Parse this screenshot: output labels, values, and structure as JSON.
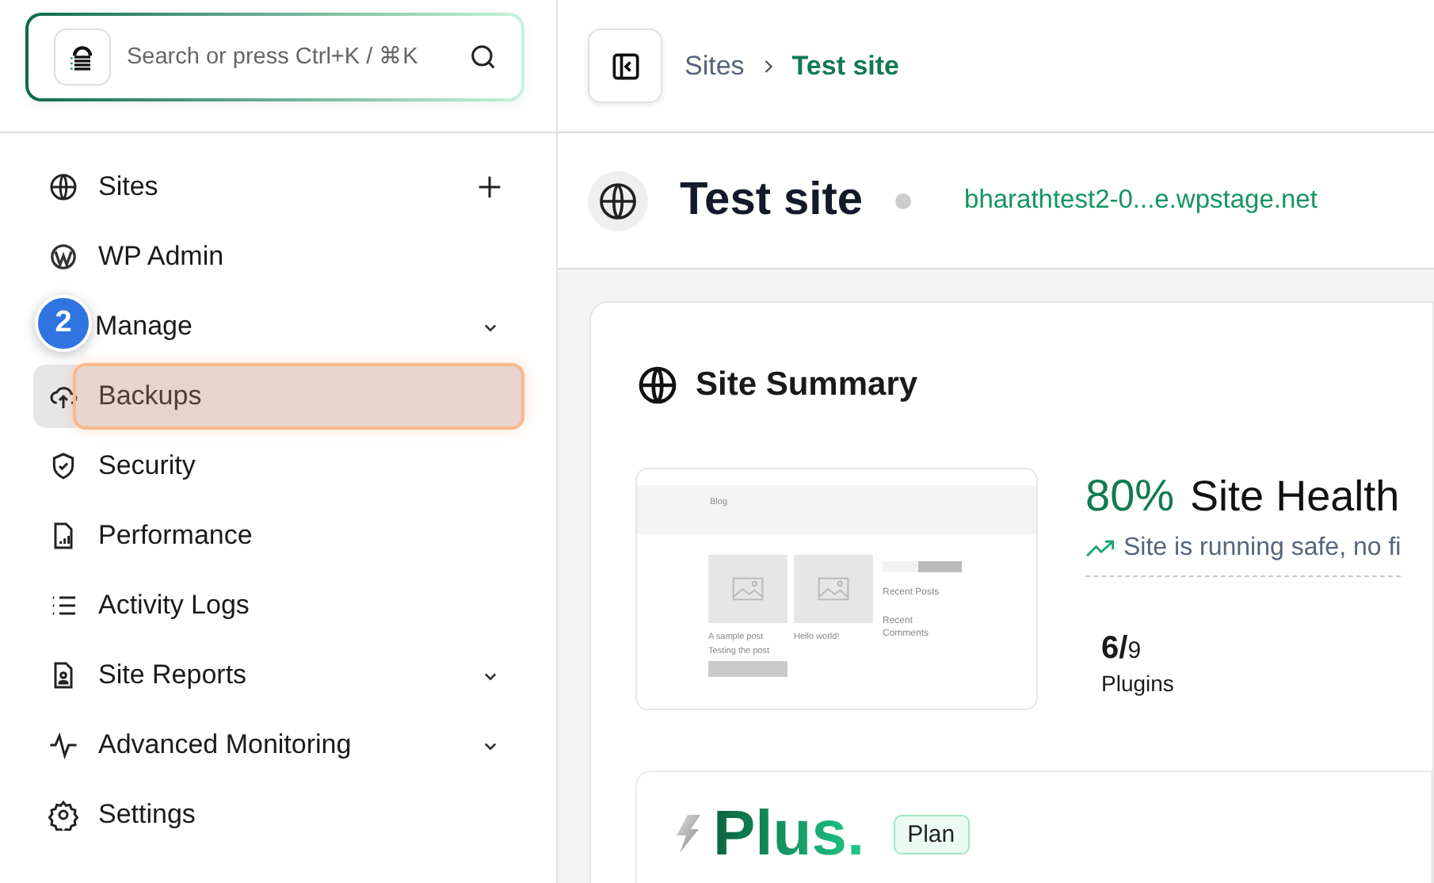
{
  "search": {
    "placeholder": "Search or press Ctrl+K / ⌘K"
  },
  "tour_step": {
    "number": "2"
  },
  "sidebar": {
    "items": [
      {
        "label": "Sites",
        "kind": "globe",
        "has_add": true,
        "has_submenu": false,
        "selected": false
      },
      {
        "label": "WP Admin",
        "kind": "wordpress",
        "has_add": false,
        "has_submenu": false,
        "selected": false
      },
      {
        "label": "Manage",
        "kind": "none",
        "has_add": false,
        "has_submenu": true,
        "selected": false
      },
      {
        "label": "Backups",
        "kind": "cloud",
        "has_add": false,
        "has_submenu": false,
        "selected": true,
        "highlighted": true
      },
      {
        "label": "Security",
        "kind": "shield",
        "has_add": false,
        "has_submenu": false,
        "selected": false
      },
      {
        "label": "Performance",
        "kind": "chart",
        "has_add": false,
        "has_submenu": false,
        "selected": false
      },
      {
        "label": "Activity Logs",
        "kind": "list",
        "has_add": false,
        "has_submenu": false,
        "selected": false
      },
      {
        "label": "Site Reports",
        "kind": "report",
        "has_add": false,
        "has_submenu": true,
        "selected": false
      },
      {
        "label": "Advanced Monitoring",
        "kind": "pulse",
        "has_add": false,
        "has_submenu": true,
        "selected": false
      },
      {
        "label": "Settings",
        "kind": "gear",
        "has_add": false,
        "has_submenu": false,
        "selected": false
      }
    ]
  },
  "breadcrumb": [
    {
      "label": "Sites",
      "current": false
    },
    {
      "label": "Test site",
      "current": true
    }
  ],
  "site": {
    "title": "Test site",
    "url": "bharathtest2-0...e.wpstage.net"
  },
  "summary": {
    "title": "Site Summary",
    "preview": {
      "header": "Blog",
      "posts": [
        {
          "title": "A sample post",
          "excerpt": "Testing the post"
        },
        {
          "title": "Hello world!"
        }
      ],
      "widgets": [
        "Recent Posts",
        "Recent Comments"
      ]
    },
    "health": {
      "percent": "80%",
      "label": "Site Health",
      "status": "Site is running safe, no fi"
    },
    "plugins": {
      "active": "6/",
      "total": "9",
      "label": "Plugins"
    }
  },
  "plan": {
    "name": "Plus.",
    "badge": "Plan"
  }
}
